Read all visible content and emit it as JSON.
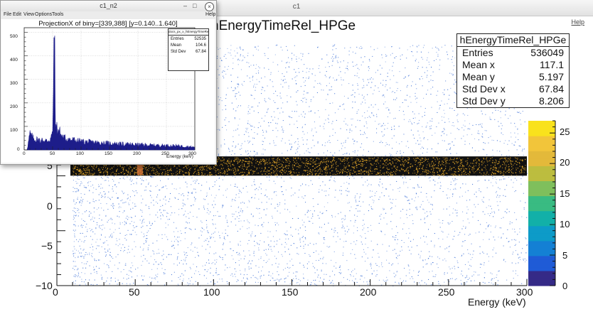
{
  "main_window": {
    "title": "c1",
    "help_menu": "Help"
  },
  "histogram": {
    "title": "hEnergyTimeRel_HPGe",
    "x_axis_title": "Energy (keV)",
    "stats": {
      "title": "hEnergyTimeRel_HPGe",
      "rows": [
        {
          "label": "Entries",
          "value": "536049"
        },
        {
          "label": "Mean x",
          "value": "117.1"
        },
        {
          "label": "Mean y",
          "value": "5.197"
        },
        {
          "label": "Std Dev x",
          "value": "67.84"
        },
        {
          "label": "Std Dev y",
          "value": "8.206"
        }
      ]
    },
    "x_ticks": [
      "0",
      "50",
      "100",
      "150",
      "200",
      "250",
      "300"
    ],
    "y_ticks": [
      "5",
      "0",
      "−5",
      "−10"
    ],
    "palette_ticks": [
      "25",
      "20",
      "15",
      "10",
      "5",
      "0"
    ],
    "colors": {
      "points": "#3b6fd6",
      "band": "#f0b02a",
      "hotspot": "#e07a3a",
      "band_bg": "#111111"
    }
  },
  "popup": {
    "title": "c1_n2",
    "window_buttons": {
      "minimize": "–",
      "maximize": "□",
      "close": "×"
    },
    "menu": {
      "file": "File",
      "edit": "Edit",
      "view": "View",
      "options": "Options",
      "tools": "Tools",
      "help": "Help"
    },
    "plot_title": "ProjectionX of biny=[339,388] [y=0.140..1.640]",
    "stats": {
      "title": "docs_px_x_hEnergyTimeRel_HPGe",
      "rows": [
        {
          "label": "Entries",
          "value": "52535"
        },
        {
          "label": "Mean",
          "value": "104.6"
        },
        {
          "label": "Std Dev",
          "value": "67.84"
        }
      ]
    },
    "x_ticks": [
      "0",
      "50",
      "100",
      "150",
      "200",
      "250",
      "300"
    ],
    "y_ticks": [
      "500",
      "400",
      "300",
      "200",
      "100",
      "0"
    ],
    "x_axis_title": "Energy (keV)"
  },
  "chart_data": [
    {
      "type": "scatter",
      "title": "hEnergyTimeRel_HPGe",
      "xlabel": "Energy (keV)",
      "ylabel": "",
      "xlim": [
        0,
        300
      ],
      "ylim": [
        -10,
        12
      ],
      "z_range": [
        0,
        30
      ],
      "band": {
        "y_range": [
          0.14,
          1.64
        ],
        "x_range": [
          10,
          300
        ]
      },
      "hotspot": {
        "x": 53,
        "y": 0.9
      }
    },
    {
      "type": "line",
      "title": "ProjectionX of biny=[339,388] [y=0.140..1.640]",
      "xlabel": "Energy (keV)",
      "ylabel": "",
      "xlim": [
        0,
        300
      ],
      "ylim": [
        0,
        520
      ],
      "x": [
        5,
        10,
        15,
        20,
        25,
        30,
        35,
        40,
        45,
        50,
        53,
        55,
        60,
        65,
        70,
        80,
        100,
        125,
        150,
        175,
        200,
        225,
        250,
        275,
        300
      ],
      "y": [
        0,
        60,
        45,
        40,
        38,
        36,
        35,
        35,
        40,
        60,
        470,
        90,
        80,
        55,
        45,
        40,
        32,
        28,
        25,
        22,
        20,
        18,
        17,
        15,
        10
      ]
    }
  ]
}
